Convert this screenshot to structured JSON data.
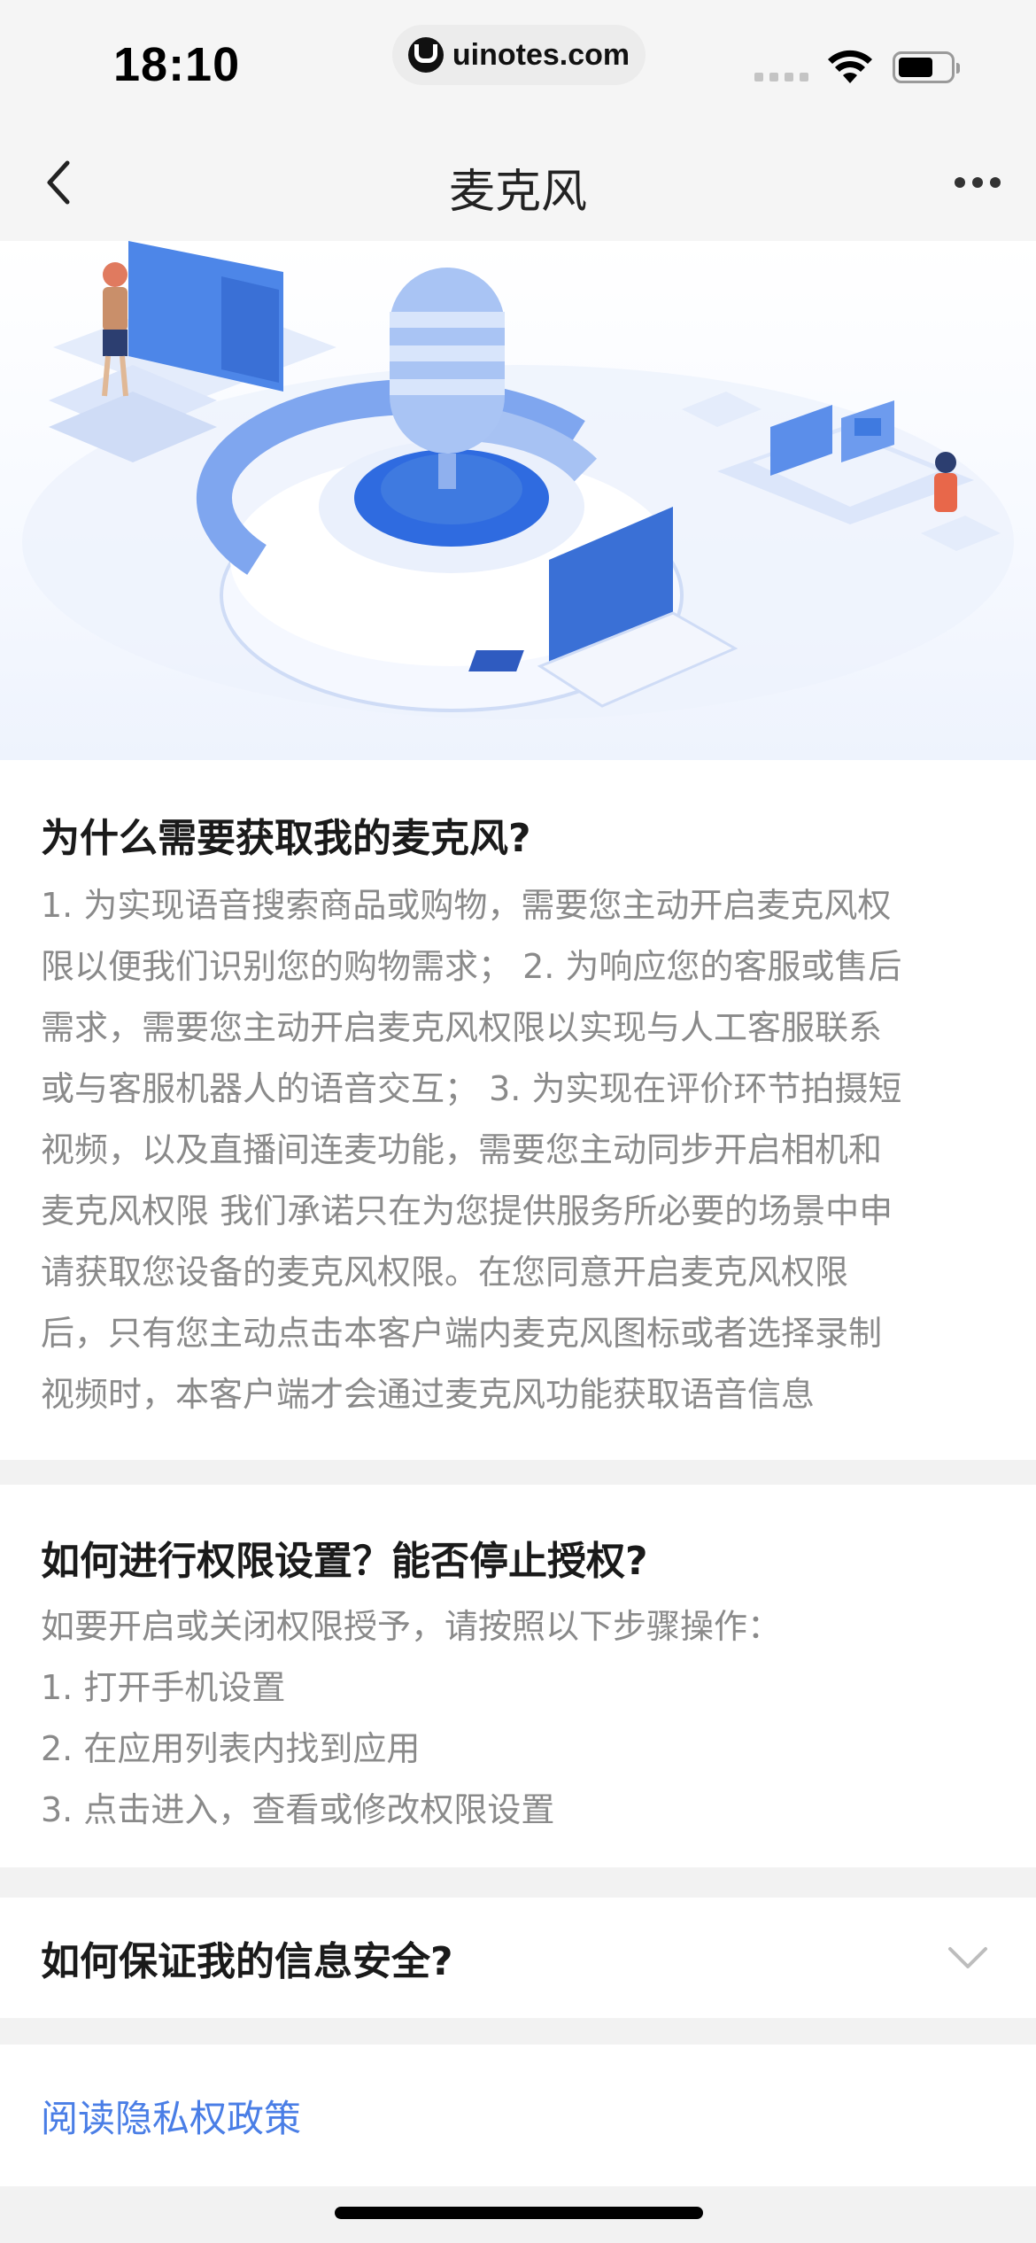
{
  "status_bar": {
    "time": "18:10",
    "url": "uinotes.com"
  },
  "nav": {
    "title": "麦克风",
    "back_icon": "chevron-left-icon",
    "more_icon": "more-dots-icon"
  },
  "hero": {
    "illustration": "microphone-isometric-illustration",
    "accent_color": "#3f7ae0"
  },
  "why_section": {
    "heading": "为什么需要获取我的麦克风?",
    "lines": [
      "1. 为实现语音搜索商品或购物，需要您主动开启麦克风权",
      "限以便我们识别您的购物需求； 2. 为响应您的客服或售后",
      "需求，需要您主动开启麦克风权限以实现与人工客服联系",
      "或与客服机器人的语音交互； 3. 为实现在评价环节拍摄短",
      "视频，以及直播间连麦功能，需要您主动同步开启相机和",
      "麦克风权限 我们承诺只在为您提供服务所必要的场景中申",
      "请获取您设备的麦克风权限。在您同意开启麦克风权限",
      "后，只有您主动点击本客户端内麦克风图标或者选择录制",
      "视频时，本客户端才会通过麦克风功能获取语音信息"
    ]
  },
  "how_section": {
    "heading": "如何进行权限设置？能否停止授权?",
    "intro": "如要开启或关闭权限授予，请按照以下步骤操作：",
    "steps": [
      "1. 打开手机设置",
      "2. 在应用列表内找到应用",
      "3. 点击进入，查看或修改权限设置"
    ]
  },
  "safety_section": {
    "heading": "如何保证我的信息安全?",
    "icon": "chevron-down-icon"
  },
  "policy": {
    "link_text": "阅读隐私权政策",
    "link_color": "#4a7ee6"
  }
}
